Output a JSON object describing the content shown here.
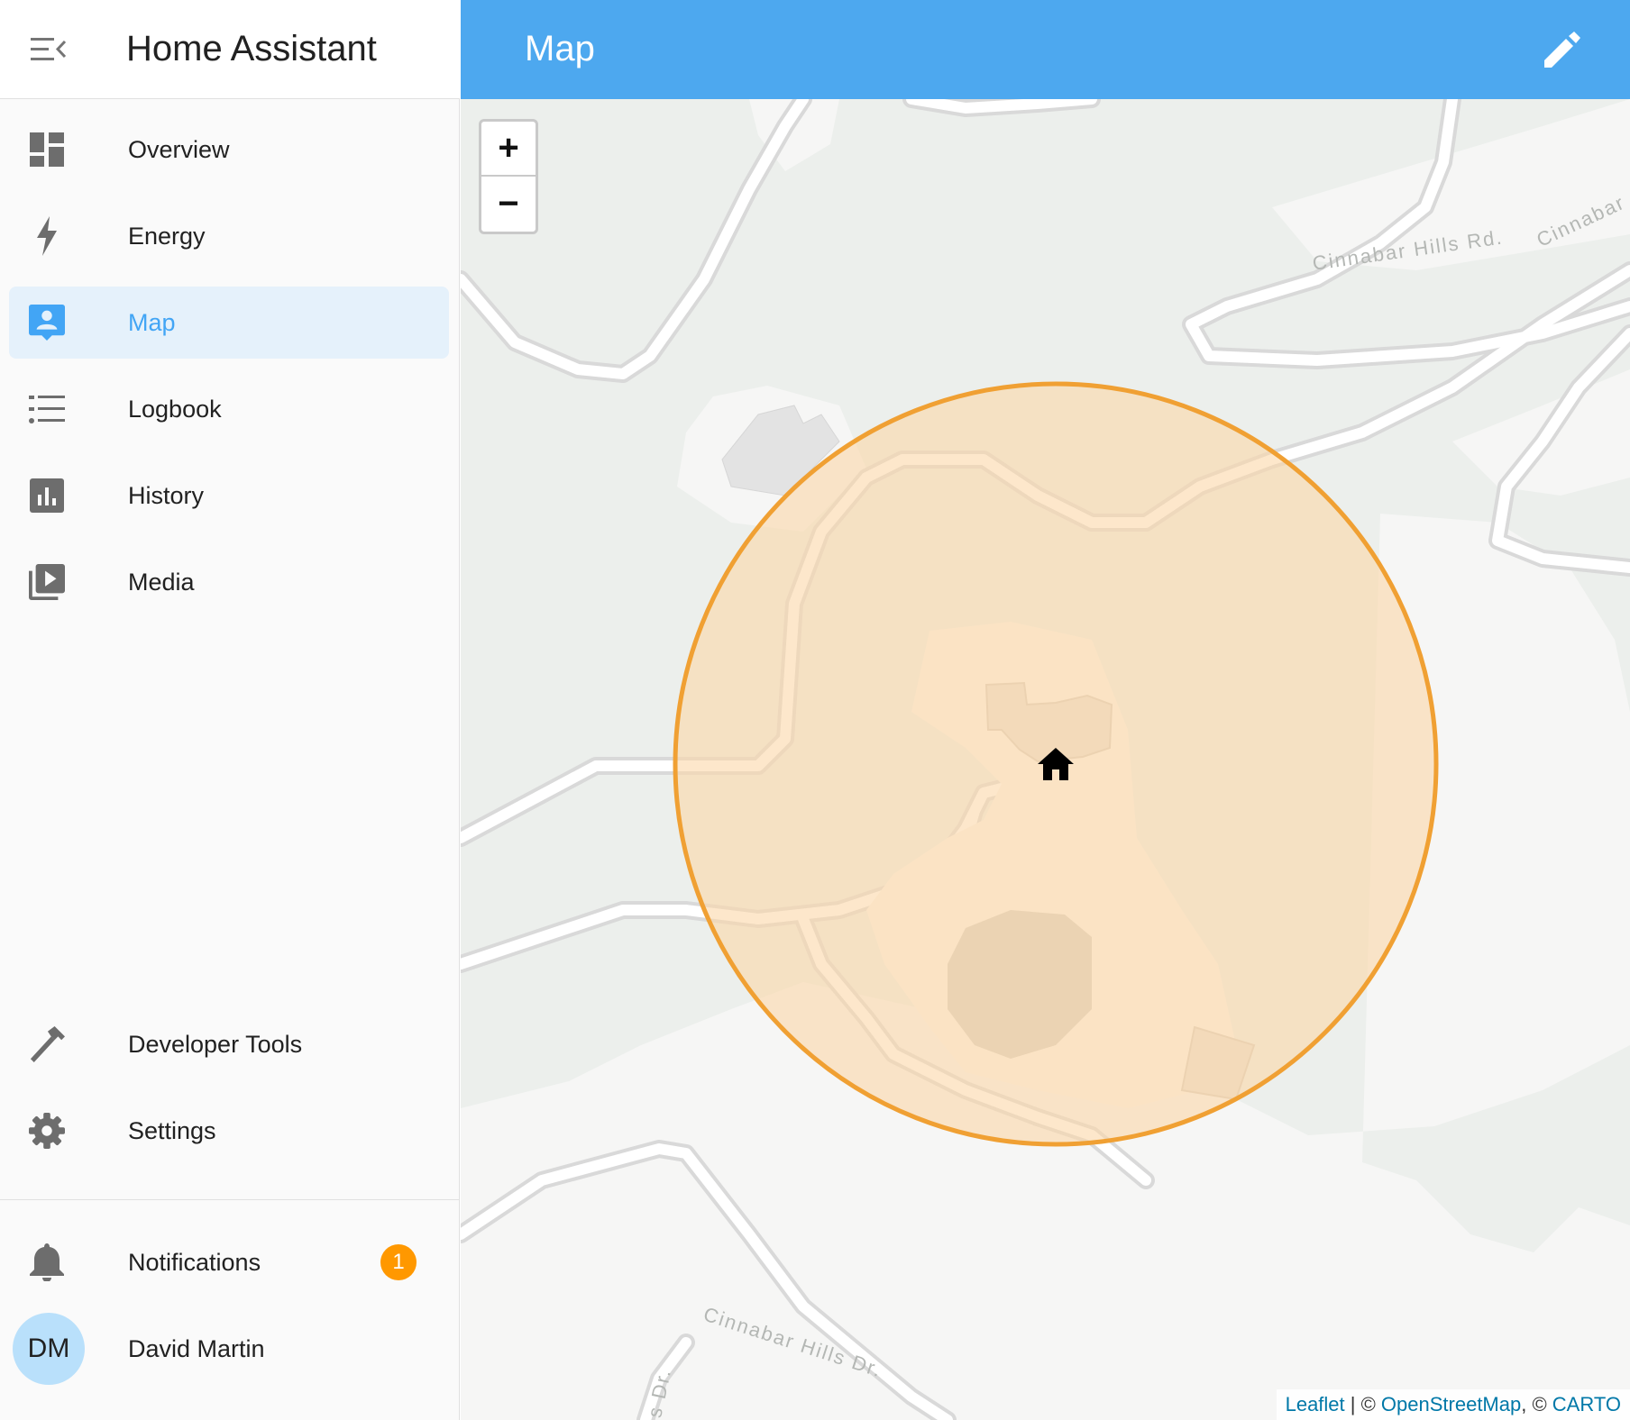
{
  "sidebar": {
    "app_title": "Home Assistant",
    "items": [
      {
        "label": "Overview",
        "icon": "dashboard-icon"
      },
      {
        "label": "Energy",
        "icon": "lightning-icon"
      },
      {
        "label": "Map",
        "icon": "map-account-icon",
        "active": true
      },
      {
        "label": "Logbook",
        "icon": "list-icon"
      },
      {
        "label": "History",
        "icon": "chart-bar-icon"
      },
      {
        "label": "Media",
        "icon": "play-box-multiple-icon"
      }
    ],
    "bottom_items": [
      {
        "label": "Developer Tools",
        "icon": "hammer-icon"
      },
      {
        "label": "Settings",
        "icon": "gear-icon"
      }
    ],
    "notifications": {
      "label": "Notifications",
      "count": "1"
    },
    "user": {
      "name": "David Martin",
      "initials": "DM"
    }
  },
  "header": {
    "title": "Map"
  },
  "map": {
    "zoom_in_label": "+",
    "zoom_out_label": "−",
    "street_labels": [
      "Cinnabar Hills Rd.",
      "Cinnabar",
      "Cinnabar Hills Dr.",
      "s Dr."
    ],
    "attribution": {
      "leaflet": "Leaflet",
      "sep1": " | © ",
      "osm": "OpenStreetMap",
      "sep2": ", © ",
      "carto": "CARTO"
    }
  },
  "colors": {
    "accent": "#42a5f5",
    "topbar": "#4da8ef",
    "zone_stroke": "#f0a033",
    "zone_fill": "#fbd7a8",
    "badge": "#ff9800"
  }
}
